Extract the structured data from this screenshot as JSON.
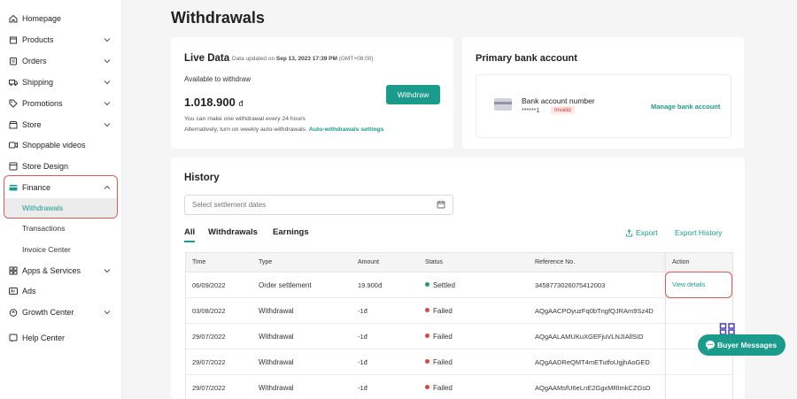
{
  "sidebar": {
    "items": [
      {
        "label": "Homepage",
        "icon": "home-icon"
      },
      {
        "label": "Products",
        "icon": "box-icon"
      },
      {
        "label": "Orders",
        "icon": "clipboard-icon"
      },
      {
        "label": "Shipping",
        "icon": "truck-icon"
      },
      {
        "label": "Promotions",
        "icon": "tag-icon"
      },
      {
        "label": "Store",
        "icon": "store-icon"
      },
      {
        "label": "Shoppable videos",
        "icon": "video-icon"
      },
      {
        "label": "Store Design",
        "icon": "layout-icon"
      },
      {
        "label": "Finance",
        "icon": "wallet-icon"
      },
      {
        "label": "Apps & Services",
        "icon": "apps-icon"
      },
      {
        "label": "Ads",
        "icon": "ads-icon"
      },
      {
        "label": "Growth Center",
        "icon": "growth-icon"
      },
      {
        "label": "Help Center",
        "icon": "help-icon"
      }
    ],
    "finance_sub": [
      "Withdrawals",
      "Transactions",
      "Invoice Center"
    ]
  },
  "page": {
    "title": "Withdrawals"
  },
  "live": {
    "title": "Live Data",
    "updated_prefix": "Data updated on ",
    "updated_date": "Sep 13, 2023 17:39 PM",
    "updated_tz": " (GMT+08:00)",
    "available_label": "Available to withdraw",
    "amount": "1.018.900",
    "currency": "đ",
    "withdraw_label": "Withdraw",
    "note1": "You can make one withdrawal every 24 hours",
    "note2": "Alternatively, turn on weekly auto-withdrawals.",
    "auto_link": "Auto-withdrawals settings"
  },
  "bank": {
    "title": "Primary bank account",
    "label": "Bank account number",
    "masked": "******1",
    "status": "Invalid",
    "manage": "Manage bank account"
  },
  "history": {
    "title": "History",
    "date_placeholder": "Select settlement dates",
    "tabs": [
      "All",
      "Withdrawals",
      "Earnings"
    ],
    "export": "Export",
    "export_history": "Export History",
    "columns": [
      "Time",
      "Type",
      "Amount",
      "Status",
      "Reference No.",
      "Action"
    ],
    "rows": [
      {
        "time": "06/09/2022",
        "type": "Order settlement",
        "amount": "19.900đ",
        "status": "Settled",
        "ref": "3458773026075412003",
        "action": "View details"
      },
      {
        "time": "03/08/2022",
        "type": "Withdrawal",
        "amount": "-1đ",
        "status": "Failed",
        "ref": "AQgAACPOyuzFq0bTngfQJRAm9Sz4D",
        "action": ""
      },
      {
        "time": "29/07/2022",
        "type": "Withdrawal",
        "amount": "-1đ",
        "status": "Failed",
        "ref": "AQgAALAMUKuXGEFjuVLNJIAllSID",
        "action": ""
      },
      {
        "time": "29/07/2022",
        "type": "Withdrawal",
        "amount": "-1đ",
        "status": "Failed",
        "ref": "AQgAADReQMT4mETutfoUgjhAoGED",
        "action": ""
      },
      {
        "time": "29/07/2022",
        "type": "Withdrawal",
        "amount": "-1đ",
        "status": "Failed",
        "ref": "AQgAAMsfU6eLnE2GgxMRlmkCZGsD",
        "action": ""
      }
    ]
  },
  "buyer_messages": "Buyer Messages",
  "colors": {
    "accent": "#1a9b8c",
    "settled": "#1aa260",
    "failed": "#e0463b",
    "highlight": "#e05a4f"
  }
}
